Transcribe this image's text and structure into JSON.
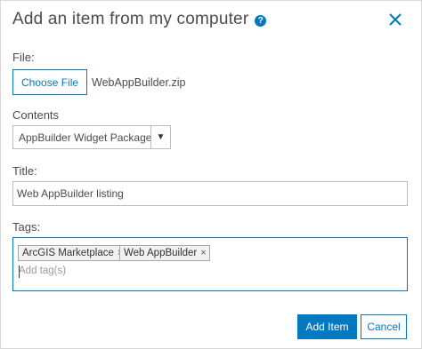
{
  "dialog": {
    "title": "Add an item from my computer",
    "help_icon": "question-circle-icon",
    "close_icon": "close-icon"
  },
  "file": {
    "label": "File:",
    "choose_button": "Choose File",
    "file_name": "WebAppBuilder.zip"
  },
  "contents": {
    "label": "Contents",
    "selected": "AppBuilder Widget Package",
    "arrow": "▼"
  },
  "title_field": {
    "label": "Title:",
    "value": "Web AppBuilder listing"
  },
  "tags": {
    "label": "Tags:",
    "items": [
      {
        "label": "ArcGIS Marketplace",
        "remove": "×"
      },
      {
        "label": "Web AppBuilder",
        "remove": "×"
      }
    ],
    "placeholder": "Add tag(s)"
  },
  "actions": {
    "primary": "Add Item",
    "secondary": "Cancel"
  },
  "colors": {
    "accent": "#0079c1",
    "text": "#4c4c4c",
    "border": "#bdbdbd"
  }
}
